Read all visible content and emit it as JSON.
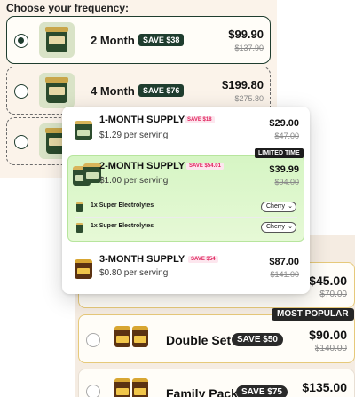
{
  "frequency": {
    "title": "Choose your frequency:",
    "options": [
      {
        "name": "2 Month",
        "badge": "SAVE $38",
        "price": "$99.90",
        "was": "$137.90",
        "selected": true
      },
      {
        "name": "4 Month",
        "badge": "SAVE $76",
        "price": "$199.80",
        "was": "$275.80",
        "selected": false
      },
      {
        "selected": false
      }
    ]
  },
  "popup": {
    "supplies": [
      {
        "name": "1-MONTH SUPPLY",
        "save": "SAVE $18",
        "serving": "$1.29 per serving",
        "price": "$29.00",
        "was": "$47.00"
      },
      {
        "name": "2-MONTH SUPPLY",
        "save": "SAVE $54.01",
        "serving": "$1.00 per serving",
        "price": "$39.99",
        "was": "$94.00",
        "highlight_badge": "LIMITED TIME"
      },
      {
        "name": "3-MONTH SUPPLY",
        "save": "SAVE $54",
        "serving": "$0.80 per serving",
        "price": "$87.00",
        "was": "$141.00"
      }
    ],
    "addons": [
      {
        "label": "1x Super Electrolytes",
        "flavor": "Cherry"
      },
      {
        "label": "1x Super Electrolytes",
        "flavor": "Cherry"
      }
    ]
  },
  "offers": {
    "most_popular": "MOST POPULAR",
    "items": [
      {
        "name": "",
        "badge": "",
        "price": "$45.00",
        "was": "$70.00"
      },
      {
        "name": "Double Set",
        "badge": "SAVE $50",
        "price": "$90.00",
        "was": "$140.00"
      },
      {
        "name": "Family Pack",
        "badge": "SAVE $75",
        "price": "$135.00",
        "was": ""
      }
    ]
  },
  "colors": {
    "brand_green": "#1f3d2f",
    "highlight_green": "#d6f5c4",
    "save_pink": "#e0245e"
  },
  "icons": {
    "radio_selected": "radio-selected-icon",
    "radio_empty": "radio-empty-icon",
    "chevron": "chevron-down-icon"
  }
}
